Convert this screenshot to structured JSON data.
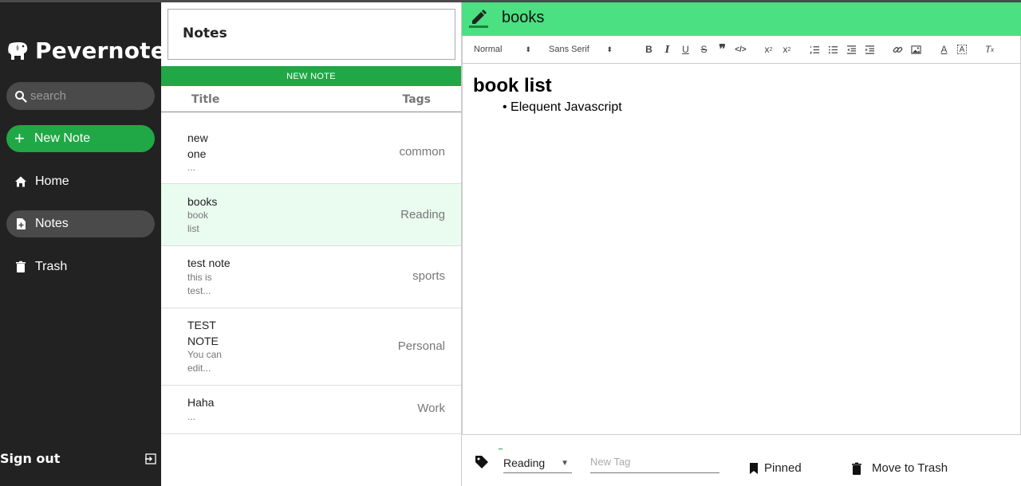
{
  "sidebar": {
    "app_name": "Pevernote",
    "search_placeholder": "search",
    "new_note_label": "New Note",
    "nav": [
      {
        "label": "Home",
        "icon": "home-icon"
      },
      {
        "label": "Notes",
        "icon": "note-add-icon"
      },
      {
        "label": "Trash",
        "icon": "trash-icon"
      }
    ],
    "signout_label": "Sign out"
  },
  "notes_panel": {
    "heading": "Notes",
    "new_note_bar": "NEW NOTE",
    "col_title": "Title",
    "col_tags": "Tags",
    "notes": [
      {
        "title_lines": [
          "new",
          "one"
        ],
        "preview_lines": [
          "..."
        ],
        "tag": "common"
      },
      {
        "title_lines": [
          "books"
        ],
        "preview_lines": [
          "book",
          "list"
        ],
        "tag": "Reading"
      },
      {
        "title_lines": [
          "test note"
        ],
        "preview_lines": [
          "this is",
          "test..."
        ],
        "tag": "sports"
      },
      {
        "title_lines": [
          "TEST",
          "NOTE"
        ],
        "preview_lines": [
          "You can",
          "edit..."
        ],
        "tag": "Personal"
      },
      {
        "title_lines": [
          "Haha"
        ],
        "preview_lines": [
          "..."
        ],
        "tag": "Work"
      }
    ]
  },
  "editor": {
    "title": "books",
    "toolbar": {
      "header_select": "Normal",
      "font_select": "Sans Serif"
    },
    "content_heading": "book list",
    "content_items": [
      "Elequent Javascript"
    ],
    "tag_value": "Reading",
    "new_tag_placeholder": "New Tag",
    "pinned_label": "Pinned",
    "trash_label": "Move to Trash"
  },
  "colors": {
    "sidebar_bg": "#222222",
    "accent_green": "#1fa845",
    "editor_header_green": "#4be081",
    "active_note_bg": "#eafcf0"
  }
}
